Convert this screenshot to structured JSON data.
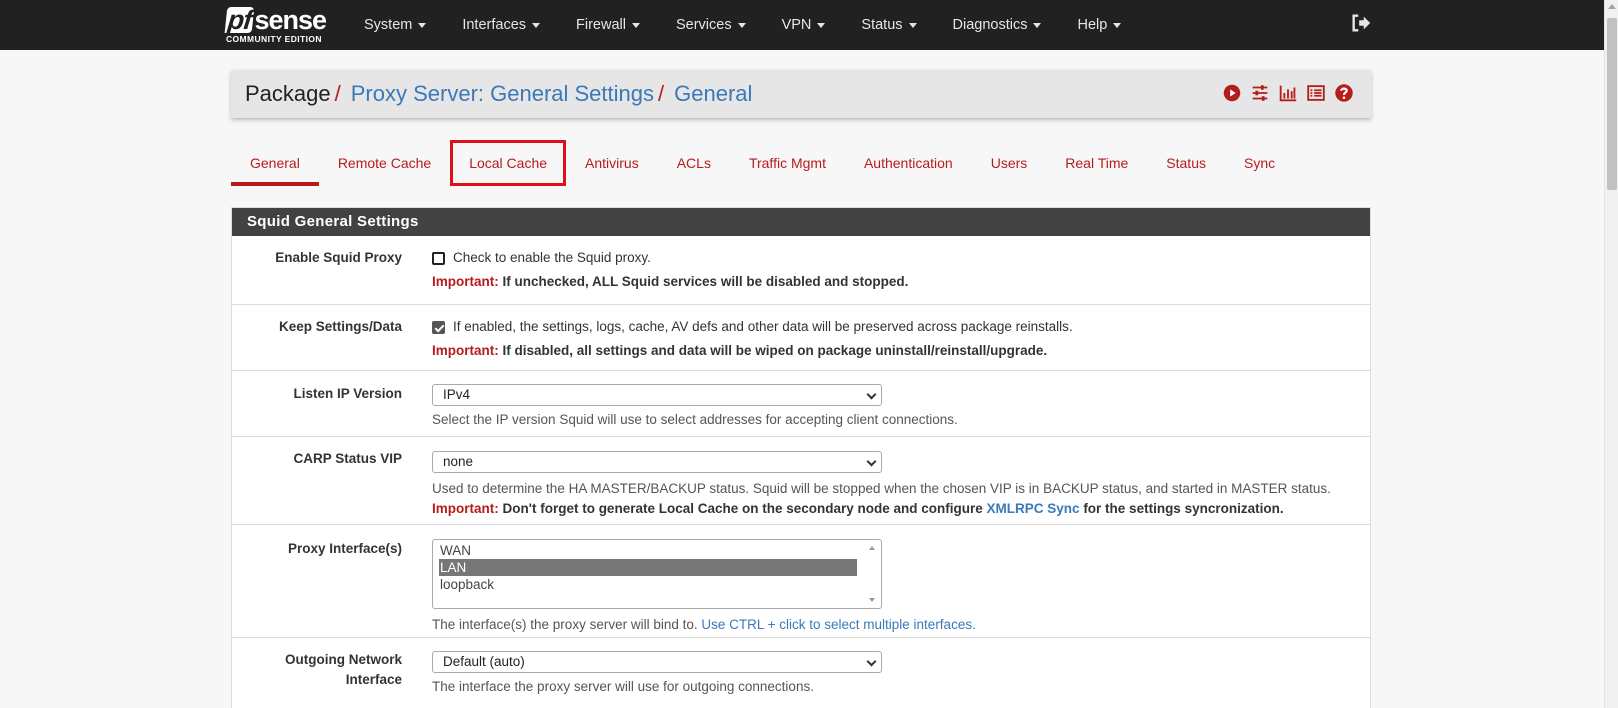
{
  "brand": {
    "logo_pf": "pf",
    "logo_text": "sense",
    "edition": "COMMUNITY EDITION"
  },
  "nav": {
    "items": [
      {
        "label": "System"
      },
      {
        "label": "Interfaces"
      },
      {
        "label": "Firewall"
      },
      {
        "label": "Services"
      },
      {
        "label": "VPN"
      },
      {
        "label": "Status"
      },
      {
        "label": "Diagnostics"
      },
      {
        "label": "Help"
      }
    ],
    "logout_icon": "logout-icon"
  },
  "breadcrumb": {
    "root": "Package",
    "section": "Proxy Server: General Settings",
    "page": "General",
    "separator": "/",
    "icons": [
      "play-circle-icon",
      "sliders-icon",
      "bar-chart-icon",
      "list-icon",
      "help-circle-icon"
    ]
  },
  "tabs": [
    {
      "label": "General"
    },
    {
      "label": "Remote Cache"
    },
    {
      "label": "Local Cache"
    },
    {
      "label": "Antivirus"
    },
    {
      "label": "ACLs"
    },
    {
      "label": "Traffic Mgmt"
    },
    {
      "label": "Authentication"
    },
    {
      "label": "Users"
    },
    {
      "label": "Real Time"
    },
    {
      "label": "Status"
    },
    {
      "label": "Sync"
    }
  ],
  "colors": {
    "accent": "#b71c1c",
    "link": "#3a7ab8",
    "navbar": "#212121",
    "panel_heading": "#424242"
  },
  "panel": {
    "title": "Squid General Settings",
    "enable_squid": {
      "label": "Enable Squid Proxy",
      "checked": false,
      "text": "Check to enable the Squid proxy.",
      "important_prefix": "Important:",
      "important_text": " If unchecked, ALL Squid services will be disabled and stopped."
    },
    "keep_settings": {
      "label": "Keep Settings/Data",
      "checked": true,
      "text": "If enabled, the settings, logs, cache, AV defs and other data will be preserved across package reinstalls.",
      "important_prefix": "Important:",
      "important_text": " If disabled, all settings and data will be wiped on package uninstall/reinstall/upgrade."
    },
    "listen_ip": {
      "label": "Listen IP Version",
      "value": "IPv4",
      "help": "Select the IP version Squid will use to select addresses for accepting client connections."
    },
    "carp_vip": {
      "label": "CARP Status VIP",
      "value": "none",
      "help": "Used to determine the HA MASTER/BACKUP status. Squid will be stopped when the chosen VIP is in BACKUP status, and started in MASTER status.",
      "important_prefix": "Important:",
      "important_text": " Don't forget to generate Local Cache on the secondary node and configure ",
      "important_link": "XMLRPC Sync",
      "important_suffix": " for the settings syncronization."
    },
    "proxy_interfaces": {
      "label": "Proxy Interface(s)",
      "options": [
        "WAN",
        "LAN",
        "loopback"
      ],
      "selected": "LAN",
      "help": "The interface(s) the proxy server will bind to. ",
      "help_link": "Use CTRL + click to select multiple interfaces."
    },
    "outgoing_interface": {
      "label_line1": "Outgoing Network",
      "label_line2": "Interface",
      "value": "Default (auto)",
      "help": "The interface the proxy server will use for outgoing connections."
    }
  }
}
